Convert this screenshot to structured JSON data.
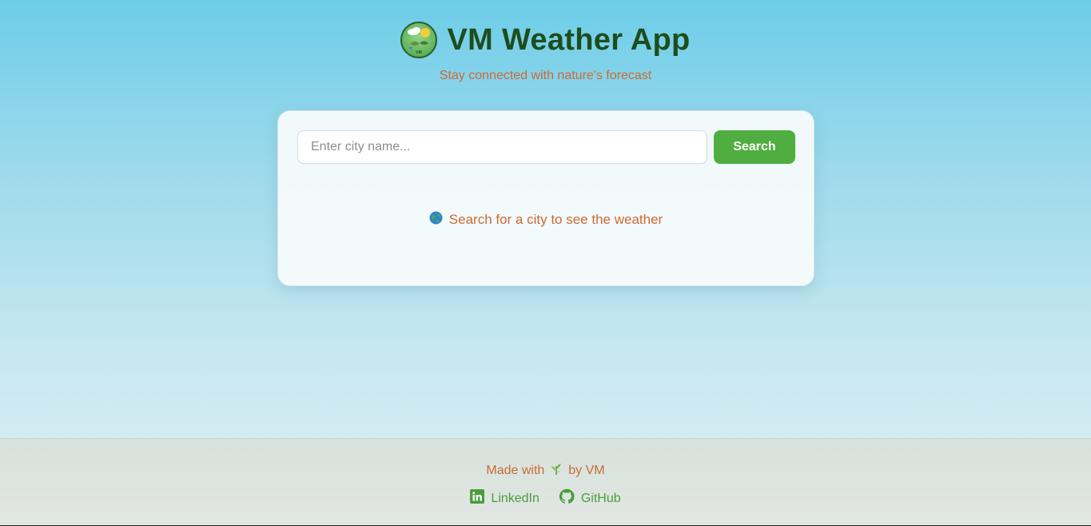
{
  "header": {
    "title": "VM Weather App",
    "subtitle": "Stay connected with nature's forecast",
    "logo_text": "VM",
    "logo_icon": "weather-logo-icon"
  },
  "search": {
    "placeholder": "Enter city name...",
    "value": "",
    "button_label": "Search"
  },
  "empty_state": {
    "icon": "globe-icon",
    "message": "Search for a city to see the weather"
  },
  "footer": {
    "made_with_prefix": "Made with",
    "made_with_icon": "herb-icon",
    "made_with_suffix": "by VM",
    "links": [
      {
        "label": "LinkedIn",
        "icon": "linkedin-icon"
      },
      {
        "label": "GitHub",
        "icon": "github-icon"
      }
    ]
  },
  "colors": {
    "title": "#1e4d1d",
    "accent_text": "#cc6a35",
    "button": "#4fae3f",
    "link": "#4a9e3b"
  }
}
